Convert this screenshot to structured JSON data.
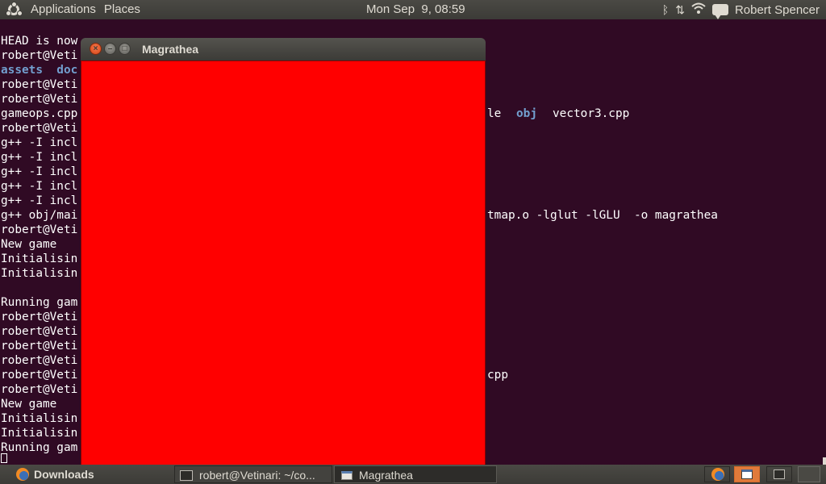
{
  "top_panel": {
    "menus": [
      "Applications",
      "Places"
    ],
    "clock": "Mon Sep  9, 08:59",
    "user": "Robert Spencer",
    "indicators": [
      "bluetooth-icon",
      "network-transfer-icon",
      "wifi-icon",
      "messaging-icon"
    ]
  },
  "terminal": {
    "lines": [
      "HEAD is now",
      "robert@Veti",
      "assets  doc",
      "robert@Veti",
      "robert@Veti",
      "gameops.cpp",
      "robert@Veti",
      "g++ -I incl",
      "g++ -I incl",
      "g++ -I incl",
      "g++ -I incl",
      "g++ -I incl",
      "g++ obj/mai",
      "robert@Veti",
      "New game",
      "Initialisin",
      "Initialisin",
      "",
      "Running gam",
      "robert@Veti",
      "robert@Veti",
      "robert@Veti",
      "robert@Veti",
      "robert@Veti",
      "robert@Veti",
      "New game",
      "Initialisin",
      "Initialisin",
      "Running gam"
    ],
    "right_fragments": {
      "line5_a": "le",
      "line5_b": "obj",
      "line5_c": "vector3.cpp",
      "line12": "tmap.o -lglut -lGLU  -o magrathea",
      "line23": "cpp"
    },
    "blue_color": "#729fcf",
    "background": "#300a24"
  },
  "window": {
    "title": "Magrathea",
    "canvas_color": "#ff0000"
  },
  "taskbar": {
    "items": [
      {
        "label": "Downloads",
        "icon": "firefox-icon"
      },
      {
        "label": "robert@Vetinari: ~/co...",
        "icon": "terminal-icon"
      },
      {
        "label": "Magrathea",
        "icon": "window-icon"
      }
    ]
  }
}
